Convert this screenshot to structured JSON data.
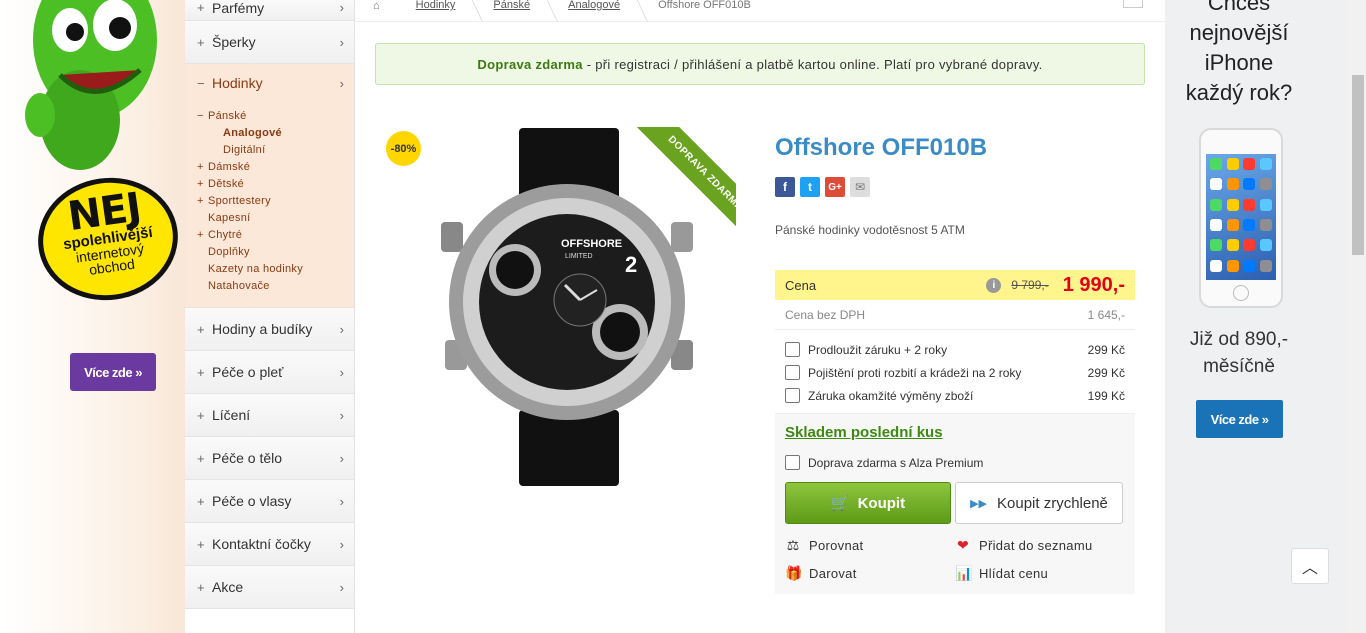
{
  "left_ad": {
    "badge_big": "NEJ",
    "badge_mid": "spolehlivější",
    "badge_small_1": "internetový",
    "badge_small_2": "obchod",
    "button": "Více zde »"
  },
  "sidebar": {
    "top_item": "Parfémy",
    "items_before": [
      {
        "label": "Šperky"
      }
    ],
    "active": "Hodinky",
    "sub": [
      {
        "prefix": "−",
        "label": "Pánské",
        "indent": false,
        "bold": false
      },
      {
        "prefix": "",
        "label": "Analogové",
        "indent": true,
        "bold": true
      },
      {
        "prefix": "",
        "label": "Digitální",
        "indent": true,
        "bold": false
      },
      {
        "prefix": "+",
        "label": "Dámské",
        "indent": false,
        "bold": false
      },
      {
        "prefix": "+",
        "label": "Dětské",
        "indent": false,
        "bold": false
      },
      {
        "prefix": "+",
        "label": "Sporttestery",
        "indent": false,
        "bold": false
      },
      {
        "prefix": "",
        "label": "Kapesní",
        "indent": false,
        "bold": false
      },
      {
        "prefix": "+",
        "label": "Chytré",
        "indent": false,
        "bold": false
      },
      {
        "prefix": "",
        "label": "Doplňky",
        "indent": false,
        "bold": false
      },
      {
        "prefix": "",
        "label": "Kazety na hodinky",
        "indent": false,
        "bold": false
      },
      {
        "prefix": "",
        "label": "Natahovače",
        "indent": false,
        "bold": false
      }
    ],
    "items_after": [
      {
        "label": "Hodiny a budíky"
      },
      {
        "label": "Péče o pleť"
      },
      {
        "label": "Líčení"
      },
      {
        "label": "Péče o tělo"
      },
      {
        "label": "Péče o vlasy"
      },
      {
        "label": "Kontaktní čočky"
      },
      {
        "label": "Akce"
      }
    ]
  },
  "breadcrumb": [
    "Hodinky",
    "Pánské",
    "Analogové"
  ],
  "breadcrumb_current": "Offshore OFF010B",
  "shipping": {
    "bold": "Doprava zdarma",
    "text": " - při registraci / přihlášení a platbě kartou online. Platí pro vybrané dopravy."
  },
  "product": {
    "discount": "-80%",
    "ribbon": "DOPRAVA ZDARMA",
    "watch_brand": "OFFSHORE",
    "watch_sub": "LIMITED",
    "title": "Offshore OFF010B",
    "description": "Pánské hodinky vodotěsnost 5 ATM",
    "price_label": "Cena",
    "old_price": "9 799,-",
    "new_price": "1 990,-",
    "novat_label": "Cena bez DPH",
    "novat_price": "1 645,-",
    "options": [
      {
        "label": "Prodloužit záruku + 2 roky",
        "price": "299 Kč"
      },
      {
        "label": "Pojištění proti rozbití a krádeži na 2 roky",
        "price": "299 Kč"
      },
      {
        "label": "Záruka okamžité výměny zboží",
        "price": "199 Kč"
      }
    ],
    "stock": "Skladem poslední kus",
    "premium": "Doprava zdarma s Alza Premium",
    "buy": "Koupit",
    "quick_buy": "Koupit zrychleně",
    "actions": [
      "Porovnat",
      "Přidat do seznamu",
      "Darovat",
      "Hlídat cenu"
    ]
  },
  "right_ad": {
    "title_lines": [
      "Chceš",
      "nejnovější",
      "iPhone",
      "každý rok?"
    ],
    "price_lines": [
      "Již od 890,-",
      "měsíčně"
    ],
    "button": "Více zde »"
  },
  "colors": {
    "accent_blue": "#3a8cc6",
    "price_red": "#e2001a",
    "green": "#6aa31f",
    "yellow": "#fff58c"
  }
}
